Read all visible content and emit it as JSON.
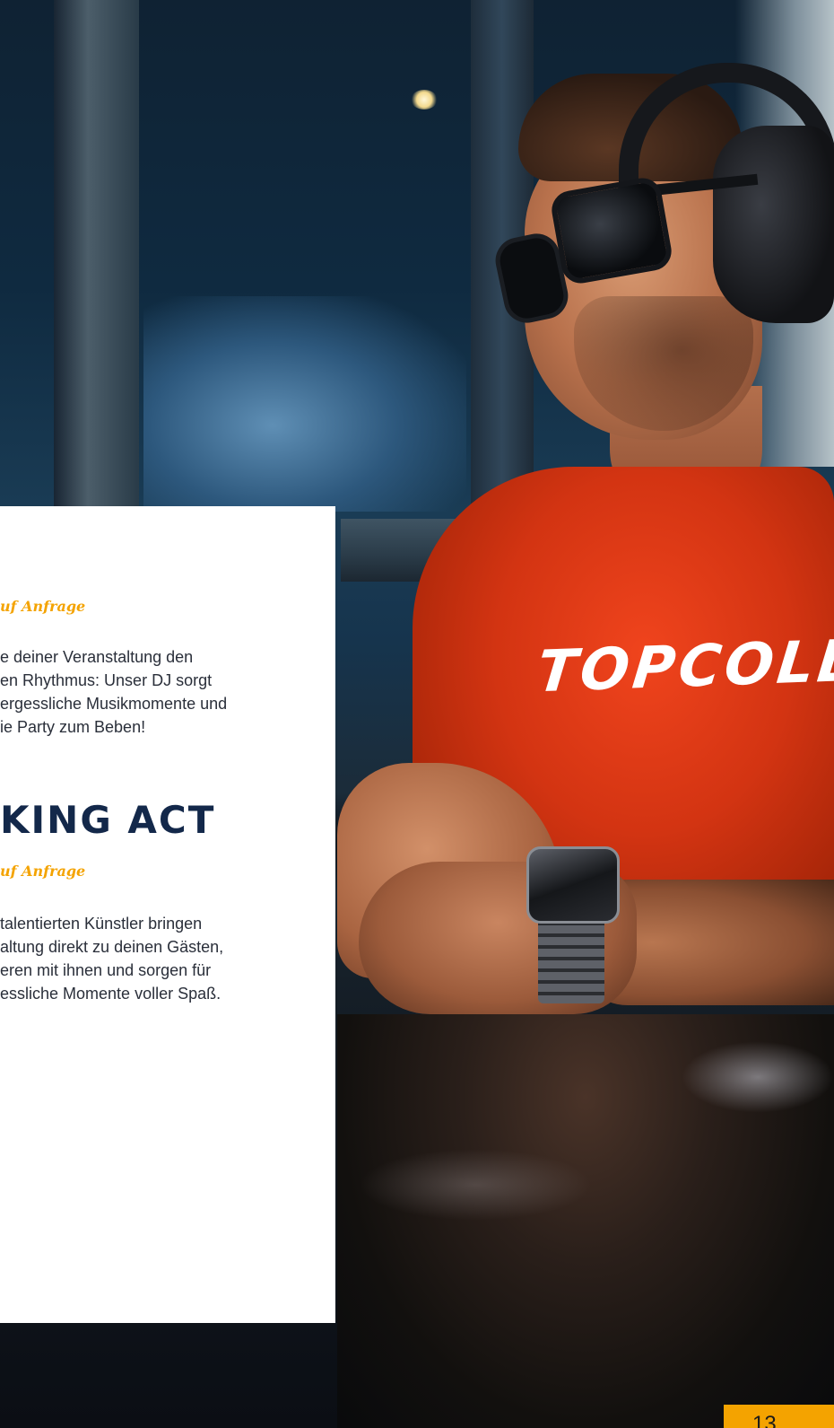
{
  "section_dj": {
    "price_label": "uf Anfrage",
    "description_lines": [
      "e deiner Veranstaltung den",
      "en Rhythmus: Unser DJ sorgt",
      "ergessliche Musikmomente und",
      "ie Party zum Beben!"
    ]
  },
  "section_walking_act": {
    "title": "KING ACT",
    "price_label": "uf Anfrage",
    "description_lines": [
      "talentierten Künstler bringen",
      "altung direkt zu deinen Gästen,",
      "eren mit ihnen und sorgen für",
      "essliche Momente voller Spaß."
    ]
  },
  "photo": {
    "shirt_text": "TOPCOLL"
  },
  "page_number": "13",
  "colors": {
    "accent": "#f4a300",
    "heading": "#13284a",
    "body": "#2a2f3a",
    "card_background": "#ffffff"
  }
}
